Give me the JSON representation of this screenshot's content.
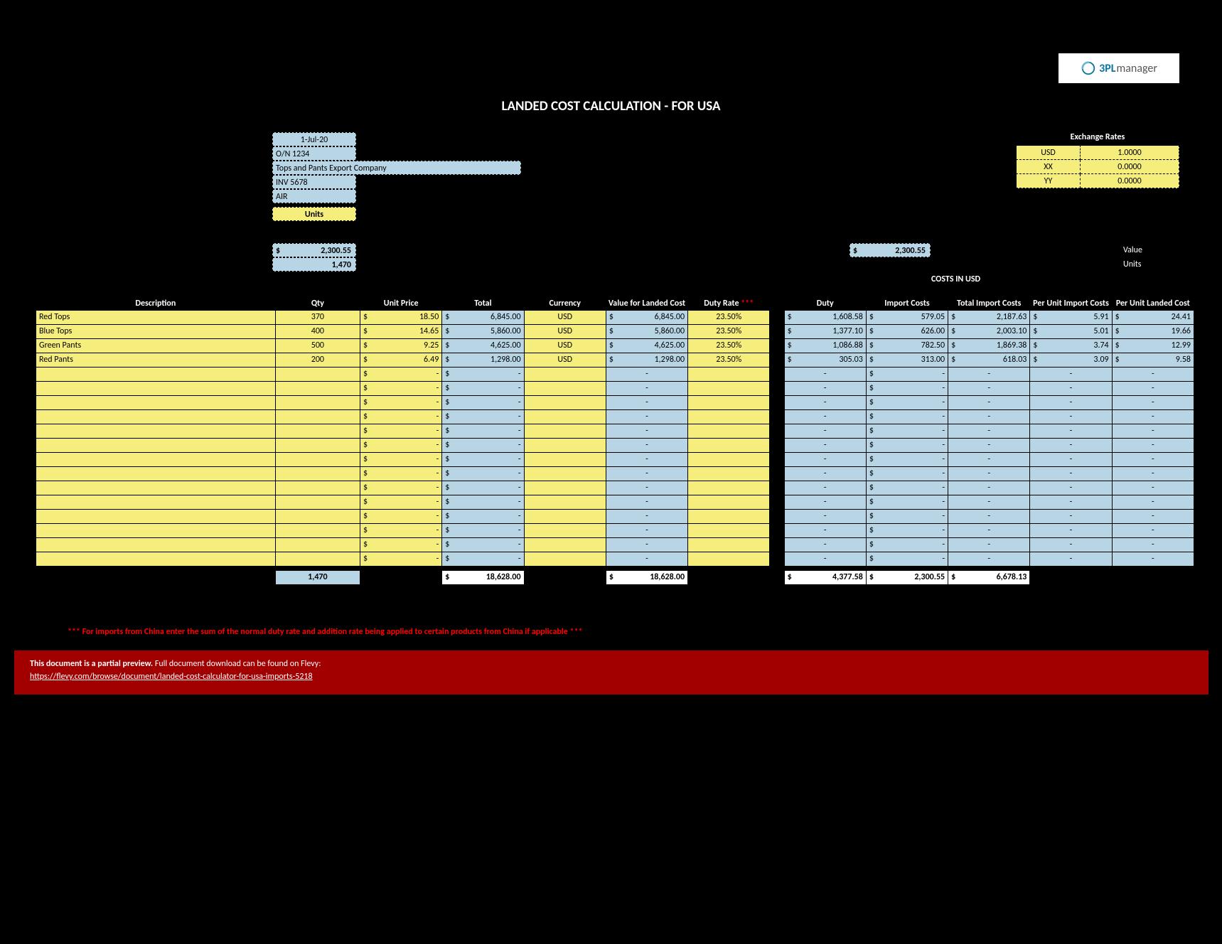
{
  "logo": {
    "brand": "3PL",
    "suffix": "manager"
  },
  "title": "LANDED COST CALCULATION - FOR USA",
  "meta": {
    "date": "1-Jul-20",
    "order_no": "O/N 1234",
    "company": "Tops and Pants Export Company",
    "invoice": "INV 5678",
    "mode": "AIR",
    "units_label": "Units"
  },
  "exchange": {
    "heading": "Exchange Rates",
    "rows": [
      {
        "code": "USD",
        "rate": "1.0000"
      },
      {
        "code": "XX",
        "rate": "0.0000"
      },
      {
        "code": "YY",
        "rate": "0.0000"
      }
    ]
  },
  "summary": {
    "import_cost_total": "2,300.55",
    "qty_total": "1,470",
    "right_value": "2,300.55",
    "side_value_label": "Value",
    "side_units_label": "Units"
  },
  "costs_in_usd_label": "COSTS IN USD",
  "headers": {
    "description": "Description",
    "qty": "Qty",
    "unit_price": "Unit Price",
    "total": "Total",
    "currency": "Currency",
    "value_for_landed": "Value for Landed Cost",
    "duty_rate": "Duty Rate",
    "duty_rate_ast": "***",
    "duty": "Duty",
    "import_costs": "Import Costs",
    "total_import_costs": "Total Import Costs",
    "per_unit_import_costs": "Per Unit Import Costs",
    "per_unit_landed_cost": "Per Unit Landed Cost"
  },
  "rows": [
    {
      "desc": "Red Tops",
      "qty": "370",
      "unit_price": "18.50",
      "total": "6,845.00",
      "currency": "USD",
      "value_landed": "6,845.00",
      "duty_rate": "23.50%",
      "duty": "1,608.58",
      "import_costs": "579.05",
      "total_import": "2,187.63",
      "pu_import": "5.91",
      "pu_landed": "24.41"
    },
    {
      "desc": "Blue Tops",
      "qty": "400",
      "unit_price": "14.65",
      "total": "5,860.00",
      "currency": "USD",
      "value_landed": "5,860.00",
      "duty_rate": "23.50%",
      "duty": "1,377.10",
      "import_costs": "626.00",
      "total_import": "2,003.10",
      "pu_import": "5.01",
      "pu_landed": "19.66"
    },
    {
      "desc": "Green Pants",
      "qty": "500",
      "unit_price": "9.25",
      "total": "4,625.00",
      "currency": "USD",
      "value_landed": "4,625.00",
      "duty_rate": "23.50%",
      "duty": "1,086.88",
      "import_costs": "782.50",
      "total_import": "1,869.38",
      "pu_import": "3.74",
      "pu_landed": "12.99"
    },
    {
      "desc": "Red Pants",
      "qty": "200",
      "unit_price": "6.49",
      "total": "1,298.00",
      "currency": "USD",
      "value_landed": "1,298.00",
      "duty_rate": "23.50%",
      "duty": "305.03",
      "import_costs": "313.00",
      "total_import": "618.03",
      "pu_import": "3.09",
      "pu_landed": "9.58"
    }
  ],
  "empty_row_count": 14,
  "totals": {
    "qty": "1,470",
    "total": "18,628.00",
    "value_landed": "18,628.00",
    "duty": "4,377.58",
    "import_costs": "2,300.55",
    "total_import": "6,678.13"
  },
  "note": "*** For imports from China enter the sum of the normal duty rate and addition rate being applied to certain products from China if applicable ***",
  "banner": {
    "text_bold": "This document is a partial preview.",
    "text_rest": " Full document download can be found on Flevy:",
    "link": "https://flevy.com/browse/document/landed-cost-calculator-for-usa-imports-5218"
  },
  "currency_symbol": "$"
}
